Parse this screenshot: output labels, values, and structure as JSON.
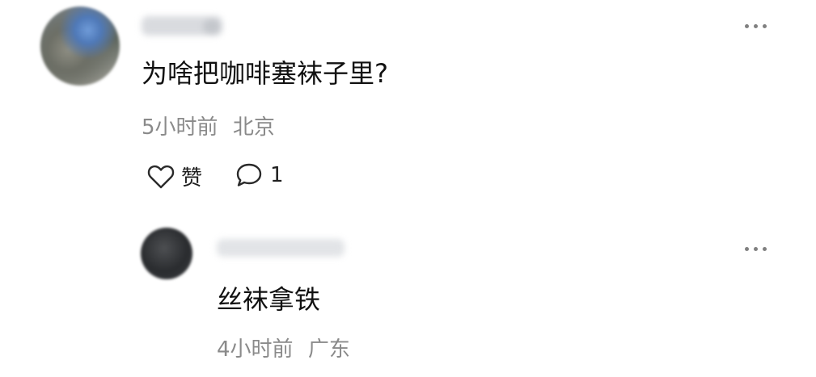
{
  "comment": {
    "text": "为啥把咖啡塞袜子里?",
    "time": "5小时前",
    "location": "北京",
    "like_label": "赞",
    "reply_count": "1"
  },
  "reply": {
    "text": "丝袜拿铁",
    "time": "4小时前",
    "location": "广东"
  },
  "icons": {
    "like": "heart-icon",
    "comment": "comment-bubble-icon",
    "more": "more-dots-icon"
  }
}
